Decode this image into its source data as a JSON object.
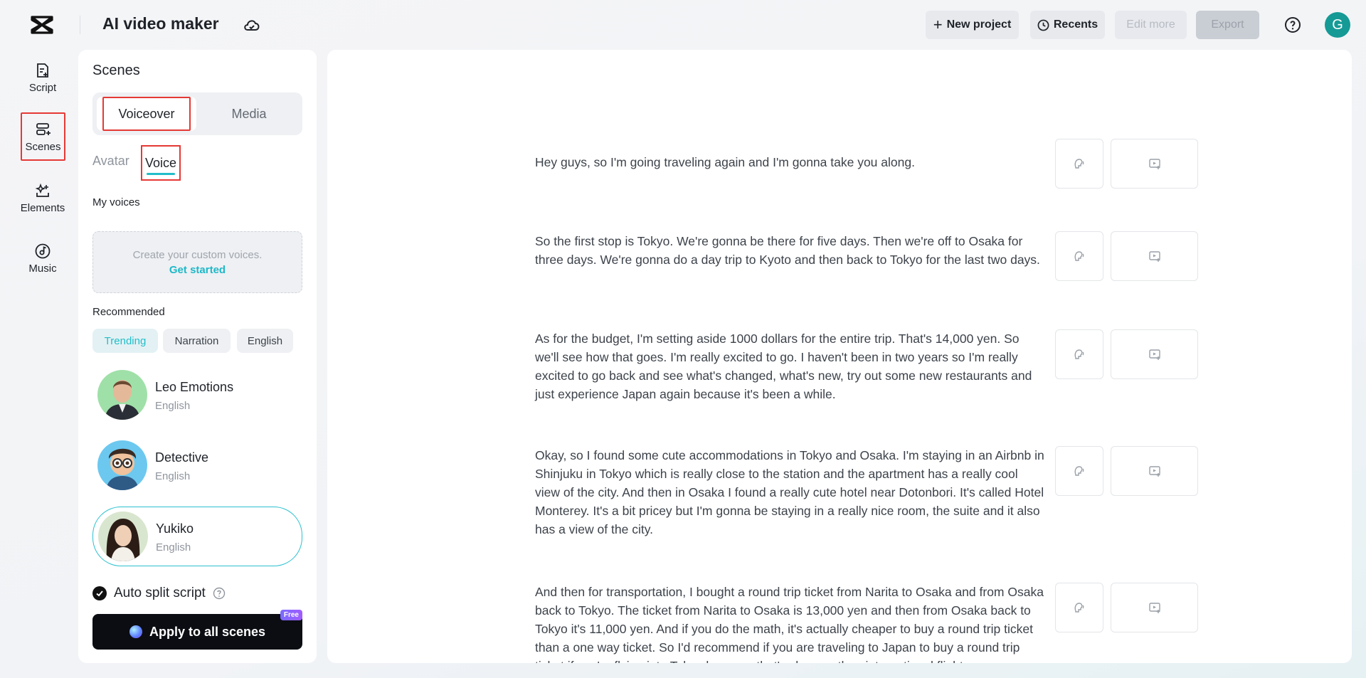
{
  "app": {
    "title": "AI video maker"
  },
  "toolbar": {
    "new_project": "New project",
    "recents": "Recents",
    "edit_more": "Edit more",
    "export": "Export",
    "user_initial": "G"
  },
  "nav": {
    "script": "Script",
    "scenes": "Scenes",
    "elements": "Elements",
    "music": "Music"
  },
  "panel": {
    "title": "Scenes",
    "tabs": {
      "voiceover": "Voiceover",
      "media": "Media"
    },
    "subtabs": {
      "avatar": "Avatar",
      "voice": "Voice"
    },
    "my_voices_label": "My voices",
    "custom_voice_text": "Create your custom voices.",
    "get_started": "Get started",
    "recommended_label": "Recommended",
    "chips": [
      "Trending",
      "Narration",
      "English"
    ],
    "voices": [
      {
        "name": "Leo Emotions",
        "lang": "English"
      },
      {
        "name": "Detective",
        "lang": "English"
      },
      {
        "name": "Yukiko",
        "lang": "English"
      }
    ],
    "auto_split": "Auto split script",
    "apply_button": "Apply to all scenes",
    "free_badge": "Free"
  },
  "scenes": [
    "Hey guys, so I'm going traveling again and I'm gonna take you along.",
    "So the first stop is Tokyo. We're gonna be there for five days. Then we're off to Osaka for three days. We're gonna do a day trip to Kyoto and then back to Tokyo for the last two days.",
    "As for the budget, I'm setting aside 1000 dollars for the entire trip. That's 14,000 yen. So we'll see how that goes. I'm really excited to go. I haven't been in two years so I'm really excited to go back and see what's changed, what's new, try out some new restaurants and just experience Japan again because it's been a while.",
    "Okay, so I found some cute accommodations in Tokyo and Osaka. I'm staying in an Airbnb in Shinjuku in Tokyo which is really close to the station and the apartment has a really cool view of the city. And then in Osaka I found a really cute hotel near Dotonbori. It's called Hotel Monterey. It's a bit pricey but I'm gonna be staying in a really nice room, the suite and it also has a view of the city.",
    "And then for transportation, I bought a round trip ticket from Narita to Osaka and from Osaka back to Tokyo. The ticket from Narita to Osaka is 13,000 yen and then from Osaka back to Tokyo it's 11,000 yen. And if you do the math, it's actually cheaper to buy a round trip ticket than a one way ticket. So I'd recommend if you are traveling to Japan to buy a round trip ticket if you're flying into Tokyo because that's cheaper than international flights."
  ],
  "colors": {
    "accent": "#22bdc9",
    "highlight_box": "#e53935",
    "avatar_bg": "#159a96"
  }
}
